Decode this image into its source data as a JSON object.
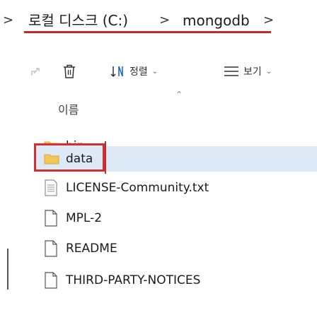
{
  "breadcrumb": {
    "lead_chevron": ">",
    "drive": "로컬 디스크 (C:)",
    "sep1": ">",
    "folder": "mongodb",
    "sep2": ">"
  },
  "toolbar": {
    "sort_label": "정렬",
    "view_label": "보기"
  },
  "list": {
    "column_name": "이름",
    "items": [
      {
        "name": "bin",
        "kind": "folder"
      },
      {
        "name": "data",
        "kind": "folder",
        "selected": true
      },
      {
        "name": "LICENSE-Community.txt",
        "kind": "text"
      },
      {
        "name": "MPL-2",
        "kind": "file"
      },
      {
        "name": "README",
        "kind": "file"
      },
      {
        "name": "THIRD-PARTY-NOTICES",
        "kind": "file"
      }
    ]
  },
  "colors": {
    "accent_red": "#d32f2f",
    "selection": "#dde9f7",
    "folder": "#f3c65a"
  }
}
